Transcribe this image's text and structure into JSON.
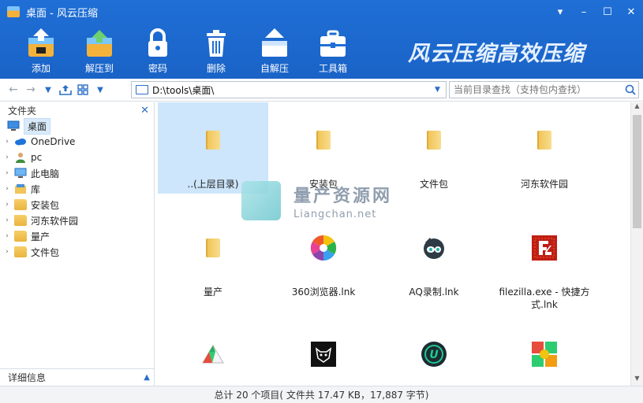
{
  "window": {
    "title": "桌面 - 风云压缩",
    "controls": [
      "▾",
      "–",
      "☐",
      "✕"
    ]
  },
  "toolbar": {
    "buttons": [
      {
        "label": "添加",
        "icon": "add-archive-icon"
      },
      {
        "label": "解压到",
        "icon": "extract-to-icon"
      },
      {
        "label": "密码",
        "icon": "lock-icon"
      },
      {
        "label": "删除",
        "icon": "trash-icon"
      },
      {
        "label": "自解压",
        "icon": "self-extract-icon"
      },
      {
        "label": "工具箱",
        "icon": "toolbox-icon"
      }
    ],
    "slogan": "风云压缩高效压缩",
    "accent": "#1f6fd6"
  },
  "address": {
    "path": "D:\\tools\\桌面\\",
    "search_placeholder": "当前目录查找（支持包内查找）"
  },
  "sidebar": {
    "header": "文件夹",
    "items": [
      {
        "label": "桌面",
        "icon": "desktop-icon",
        "selected": true
      },
      {
        "label": "OneDrive",
        "icon": "cloud-icon"
      },
      {
        "label": "pc",
        "icon": "user-icon"
      },
      {
        "label": "此电脑",
        "icon": "computer-icon"
      },
      {
        "label": "库",
        "icon": "library-icon"
      },
      {
        "label": "安装包",
        "icon": "folder-icon"
      },
      {
        "label": "河东软件园",
        "icon": "folder-icon"
      },
      {
        "label": "量产",
        "icon": "folder-icon"
      },
      {
        "label": "文件包",
        "icon": "folder-icon"
      }
    ],
    "detail_label": "详细信息"
  },
  "content": {
    "items": [
      {
        "label": "..(上层目录)",
        "type": "folder",
        "selected": true
      },
      {
        "label": "安装包",
        "type": "folder"
      },
      {
        "label": "文件包",
        "type": "folder"
      },
      {
        "label": "河东软件园",
        "type": "folder"
      },
      {
        "label": "量产",
        "type": "folder"
      },
      {
        "label": "360浏览器.lnk",
        "type": "browser-360"
      },
      {
        "label": "AQ录制.lnk",
        "type": "aq-recorder"
      },
      {
        "label": "filezilla.exe - 快捷方式.lnk",
        "type": "filezilla"
      },
      {
        "label": "",
        "type": "app-pie"
      },
      {
        "label": "",
        "type": "app-wolf"
      },
      {
        "label": "",
        "type": "app-u"
      },
      {
        "label": "",
        "type": "app-puzzle"
      }
    ]
  },
  "watermark": {
    "line1": "量产资源网",
    "line2": "Liangchan.net"
  },
  "status": {
    "text": "总计 20 个项目( 文件共 17.47 KB，17,887 字节)"
  }
}
